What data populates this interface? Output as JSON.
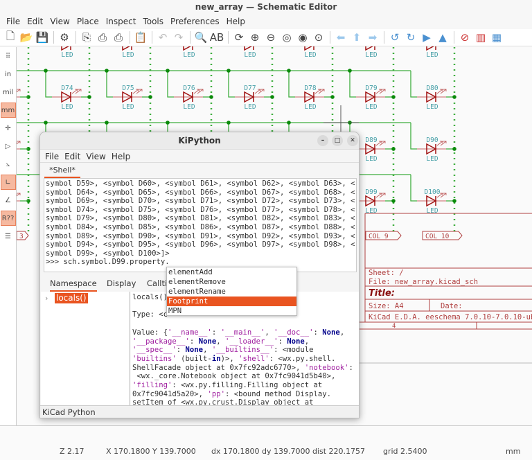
{
  "window": {
    "title": "new_array — Schematic Editor"
  },
  "menu": [
    "File",
    "Edit",
    "View",
    "Place",
    "Inspect",
    "Tools",
    "Preferences",
    "Help"
  ],
  "toolbar": [
    {
      "icon": "new-icon",
      "glyph": "🗋"
    },
    {
      "icon": "open-folder-icon",
      "glyph": "📂"
    },
    {
      "icon": "save-icon",
      "glyph": "💾"
    },
    {
      "sep": true
    },
    {
      "icon": "schematic-setup-icon",
      "glyph": "⚙"
    },
    {
      "sep": true
    },
    {
      "icon": "page-settings-icon",
      "glyph": "⎘"
    },
    {
      "icon": "print-icon",
      "glyph": "⎙"
    },
    {
      "icon": "plot-icon",
      "glyph": "⎙"
    },
    {
      "sep": true
    },
    {
      "icon": "paste-icon",
      "glyph": "📋"
    },
    {
      "sep": true
    },
    {
      "icon": "undo-icon",
      "glyph": "↶",
      "cls": "gray"
    },
    {
      "icon": "redo-icon",
      "glyph": "↷",
      "cls": "gray"
    },
    {
      "sep": true
    },
    {
      "icon": "find-icon",
      "glyph": "🔍"
    },
    {
      "icon": "find-replace-icon",
      "glyph": "AB"
    },
    {
      "sep": true
    },
    {
      "icon": "refresh-icon",
      "glyph": "⟳"
    },
    {
      "icon": "zoom-in-icon",
      "glyph": "⊕"
    },
    {
      "icon": "zoom-out-icon",
      "glyph": "⊖"
    },
    {
      "icon": "zoom-fit-icon",
      "glyph": "◎"
    },
    {
      "icon": "zoom-objects-icon",
      "glyph": "◉"
    },
    {
      "icon": "zoom-selection-icon",
      "glyph": "⊙"
    },
    {
      "sep": true
    },
    {
      "icon": "navigate-back-icon",
      "glyph": "⬅",
      "cls": "lblue"
    },
    {
      "icon": "navigate-up-icon",
      "glyph": "⬆",
      "cls": "lblue"
    },
    {
      "icon": "navigate-forward-icon",
      "glyph": "➡",
      "cls": "lblue"
    },
    {
      "sep": true
    },
    {
      "icon": "rotate-ccw-icon",
      "glyph": "↺",
      "cls": "blue"
    },
    {
      "icon": "rotate-cw-icon",
      "glyph": "↻",
      "cls": "blue"
    },
    {
      "icon": "mirror-v-icon",
      "glyph": "▶",
      "cls": "blue"
    },
    {
      "icon": "mirror-h-icon",
      "glyph": "▲",
      "cls": "blue"
    },
    {
      "sep": true
    },
    {
      "icon": "symbol-editor-icon",
      "glyph": "⊘",
      "cls": "red"
    },
    {
      "icon": "symbol-browser-icon",
      "glyph": "▥",
      "cls": "red"
    },
    {
      "icon": "annotate-icon",
      "glyph": "▦",
      "cls": "blue"
    }
  ],
  "left_toolbar": [
    {
      "icon": "grid-icon",
      "glyph": "⠿"
    },
    {
      "icon": "units-in-icon",
      "glyph": "in"
    },
    {
      "icon": "units-mil-icon",
      "glyph": "mil"
    },
    {
      "icon": "units-mm-icon",
      "glyph": "mm",
      "active": true
    },
    {
      "icon": "cursor-icon",
      "glyph": "✛"
    },
    {
      "icon": "hidden-pins-icon",
      "glyph": "▷"
    },
    {
      "icon": "line-mode-free-icon",
      "glyph": "⦣"
    },
    {
      "icon": "line-mode-90-icon",
      "glyph": "∟",
      "active": true
    },
    {
      "icon": "line-mode-45-icon",
      "glyph": "∠"
    },
    {
      "icon": "annotation-icon",
      "glyph": "R??",
      "active": true
    },
    {
      "icon": "hierarchy-navigator-icon",
      "glyph": "☰"
    }
  ],
  "schematic": {
    "wire_color": "#3fae3f",
    "symbol_color": "#a01010",
    "ref_color": "#48a0a8",
    "sheet_color": "#b04040",
    "rows": [
      {
        "refs": [
          "",
          "",
          "",
          "",
          "",
          "",
          ""
        ],
        "values": [
          "LED",
          "LED",
          "LED",
          "LED",
          "LED",
          "LED",
          "LED"
        ]
      },
      {
        "refs": [
          "D74",
          "D75",
          "D76",
          "D77",
          "D78",
          "D79",
          "D80"
        ],
        "values": [
          "LED",
          "LED",
          "LED",
          "LED",
          "LED",
          "LED",
          "LED"
        ]
      },
      {
        "refs": [
          "",
          "",
          "",
          "",
          "",
          "D89",
          "D90"
        ],
        "values": [
          "",
          "",
          "",
          "",
          "",
          "LED",
          "LED"
        ]
      },
      {
        "refs": [
          "",
          "",
          "",
          "",
          "",
          "D99",
          "D100"
        ],
        "values": [
          "",
          "",
          "",
          "",
          "",
          "LED",
          "LED"
        ]
      }
    ],
    "labels": [
      "3",
      "COL_9",
      "COL_10"
    ],
    "title_block": {
      "sheet": "Sheet: /",
      "file": "File: new_array.kicad_sch",
      "title": "Title:",
      "size": "Size: A4",
      "date": "Date:",
      "kicad": "KiCad E.D.A.  eeschema 7.0.10-7.0.10-ub",
      "row_number": "4"
    }
  },
  "status": {
    "zoom": "Z 2.17",
    "xy": "X 170.1800  Y 139.7000",
    "delta": "dx 170.1800  dy 139.7000  dist 220.1757",
    "grid": "grid 2.5400",
    "units": "mm"
  },
  "kipython": {
    "title": "KiPython",
    "menu": [
      "File",
      "Edit",
      "View",
      "Help"
    ],
    "shell_tab": "*Shell*",
    "shell_lines": [
      "symbol D59>, <symbol D60>, <symbol D61>, <symbol D62>, <symbol D63>, <",
      "symbol D64>, <symbol D65>, <symbol D66>, <symbol D67>, <symbol D68>, <",
      "symbol D69>, <symbol D70>, <symbol D71>, <symbol D72>, <symbol D73>, <",
      "symbol D74>, <symbol D75>, <symbol D76>, <symbol D77>, <symbol D78>, <",
      "symbol D79>, <symbol D80>, <symbol D81>, <symbol D82>, <symbol D83>, <",
      "symbol D84>, <symbol D85>, <symbol D86>, <symbol D87>, <symbol D88>, <",
      "symbol D89>, <symbol D90>, <symbol D91>, <symbol D92>, <symbol D93>, <",
      "symbol D94>, <symbol D95>, <symbol D96>, <symbol D97>, <symbol D98>, <",
      "symbol D99>, <symbol D100>]>",
      ">>> sch.symbol.D99.property."
    ],
    "autocomplete": {
      "items": [
        "elementAdd",
        "elementRemove",
        "elementRename",
        "Footprint",
        "MPN"
      ],
      "selected": "Footprint"
    },
    "lower_tabs": [
      "Namespace",
      "Display",
      "Calltip"
    ],
    "tree_node": "locals()",
    "detail": {
      "header": "locals()",
      "type": "Type: <c",
      "value_lines": [
        [
          [
            "",
            "Value: {"
          ],
          [
            "s",
            "'__name__'"
          ],
          [
            "",
            ": "
          ],
          [
            "s",
            "'__main__'"
          ],
          [
            "",
            ", "
          ],
          [
            "s",
            "'__doc__'"
          ],
          [
            "",
            ": "
          ],
          [
            "k",
            "None"
          ],
          [
            "",
            ","
          ]
        ],
        [
          [
            "s",
            "'__package__'"
          ],
          [
            "",
            ": "
          ],
          [
            "k",
            "None"
          ],
          [
            "",
            ", "
          ],
          [
            "s",
            "'__loader__'"
          ],
          [
            "",
            ": "
          ],
          [
            "k",
            "None"
          ],
          [
            "",
            ","
          ]
        ],
        [
          [
            "s",
            "'__spec__'"
          ],
          [
            "",
            ": "
          ],
          [
            "k",
            "None"
          ],
          [
            "",
            ", "
          ],
          [
            "s",
            "'__builtins__'"
          ],
          [
            "",
            ": <module"
          ]
        ],
        [
          [
            "s",
            "'builtins'"
          ],
          [
            "",
            " (built-"
          ],
          [
            "k",
            "in"
          ],
          [
            "",
            ")>, "
          ],
          [
            "s",
            "'shell'"
          ],
          [
            "",
            ": <wx.py.shell."
          ]
        ],
        [
          [
            "",
            "ShellFacade object at 0x7fc92adc6770>, "
          ],
          [
            "s",
            "'notebook'"
          ],
          [
            "",
            ":"
          ]
        ],
        [
          [
            "",
            " <wx._core.Notebook object at 0x7fc9041d5b40>,"
          ]
        ],
        [
          [
            "s",
            "'filling'"
          ],
          [
            "",
            ": <wx.py.filling.Filling object at"
          ]
        ],
        [
          [
            "",
            "0x7fc9041d5a20>, "
          ],
          [
            "s",
            "'pp'"
          ],
          [
            "",
            ": <bound method Display."
          ]
        ],
        [
          [
            "",
            "setItem of <wx.py.crust.Display object at"
          ]
        ]
      ]
    },
    "status": "KiCad Python"
  }
}
